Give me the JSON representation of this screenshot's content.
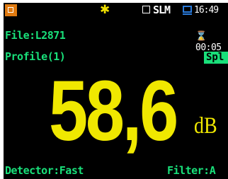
{
  "status": {
    "mode": "SLM",
    "time": "16:49",
    "colors": {
      "battery_icon": "#e07a10",
      "sun_icon": "#f0e000",
      "screen_icon": "#2a7bdc"
    },
    "icons": [
      "record-indicator-icon",
      "backlight-sun-icon",
      "slm-mode-checkbox-icon",
      "display-screen-icon"
    ]
  },
  "file": {
    "label": "File:L2871"
  },
  "timer": {
    "text": "⌛00:05"
  },
  "profile": {
    "label": "Profile(1)"
  },
  "measurement": {
    "badge": "Spl",
    "value": "58,6",
    "unit": "dB"
  },
  "footer": {
    "detector": "Detector:Fast",
    "filter": "Filter:A"
  },
  "theme": {
    "background": "#000000",
    "primary_text": "#19e07a",
    "value_color": "#f0e800"
  }
}
